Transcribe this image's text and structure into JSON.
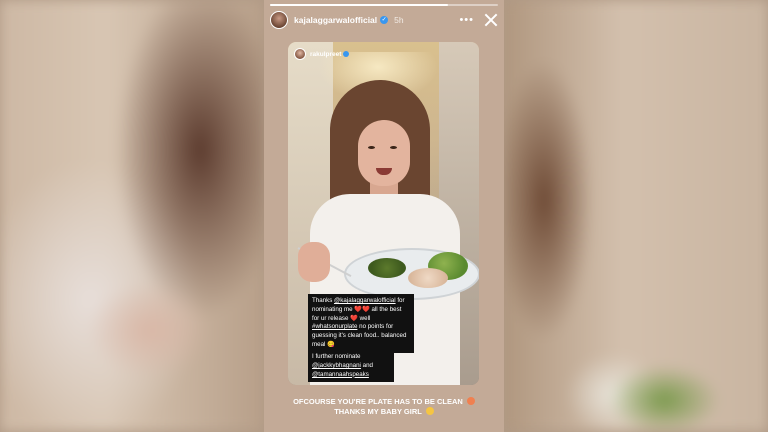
{
  "story": {
    "username": "kajalaggarwalofficial",
    "time": "5h",
    "more_label": "•••",
    "progress": 0.78
  },
  "card": {
    "username": "rakulpreet"
  },
  "caption": {
    "thanks": "Thanks",
    "mention1": "@kajalaggarwalofficial",
    "for_text": "for nominating me",
    "hearts": "❤️❤️",
    "best": "all the best for ur release",
    "heart2": "❤️",
    "well": "well",
    "hashtag": "#whatsonurplate",
    "points": "no points for guessing it's clean food.. balanced meal",
    "emoji": "😋"
  },
  "nominate": {
    "line1": "I further nominate",
    "mention2": "@jackkybhagnani",
    "and": "and",
    "mention3": "@tamannaahspeaks"
  },
  "reply": {
    "line1": "OFCOURSE YOU'RE PLATE HAS TO BE CLEAN",
    "line2": "THANKS MY BABY GIRL"
  }
}
